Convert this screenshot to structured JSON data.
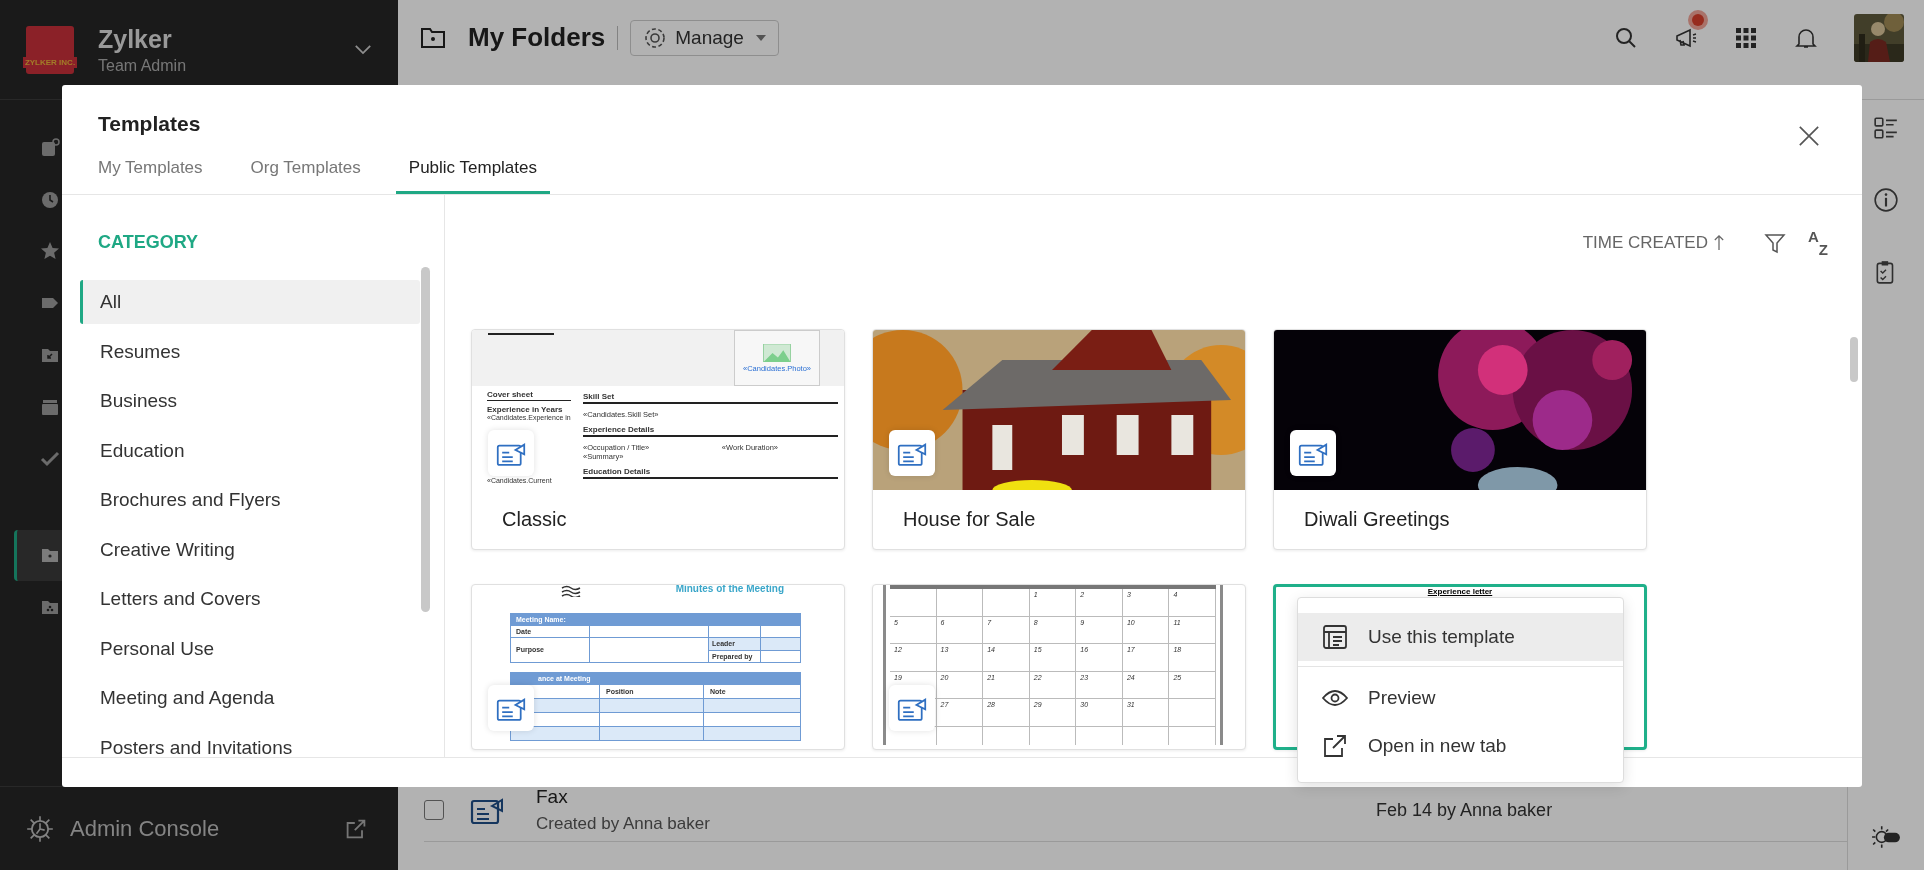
{
  "sidebar": {
    "org": {
      "name": "Zylker",
      "role": "Team Admin",
      "logo_text": "ZYLKER INC."
    },
    "nav": [
      {
        "selected": false
      },
      {
        "selected": false
      },
      {
        "selected": false
      },
      {
        "selected": false
      },
      {
        "selected": false
      },
      {
        "selected": false
      },
      {
        "selected": false
      },
      {
        "selected": true
      },
      {
        "selected": false
      }
    ],
    "footer": {
      "label": "Admin Console"
    }
  },
  "topbar": {
    "title": "My Folders",
    "manage": "Manage"
  },
  "list": {
    "rows": [
      {
        "name": "Fax",
        "created": "Created by Anna baker",
        "modified": "Feb 14 by Anna baker",
        "checked": false
      }
    ]
  },
  "modal": {
    "title": "Templates",
    "tabs": [
      {
        "label": "My Templates",
        "selected": false
      },
      {
        "label": "Org Templates",
        "selected": false
      },
      {
        "label": "Public Templates",
        "selected": true
      }
    ],
    "category": {
      "heading": "CATEGORY",
      "items": [
        {
          "label": "All",
          "selected": true
        },
        {
          "label": "Resumes",
          "selected": false
        },
        {
          "label": "Business",
          "selected": false
        },
        {
          "label": "Education",
          "selected": false
        },
        {
          "label": "Brochures and Flyers",
          "selected": false
        },
        {
          "label": "Creative Writing",
          "selected": false
        },
        {
          "label": "Letters and Covers",
          "selected": false
        },
        {
          "label": "Personal Use",
          "selected": false
        },
        {
          "label": "Meeting and Agenda",
          "selected": false
        },
        {
          "label": "Posters and Invitations",
          "selected": false
        }
      ]
    },
    "sort": {
      "label": "TIME CREATED",
      "letters": [
        "A",
        "Z"
      ]
    },
    "cards": [
      {
        "name": "Classic",
        "selected": false,
        "thumb": {
          "kind": "resume",
          "photo_label": "«Candidates.Photo»",
          "left": [
            {
              "kind": "heading",
              "text": "Cover sheet"
            },
            {
              "kind": "label",
              "text": "Experience in Years"
            },
            {
              "kind": "field",
              "text": "«Candidates.Experience in"
            },
            {
              "kind": "low",
              "text": "«Candidates.Current"
            }
          ],
          "right": [
            {
              "kind": "heading",
              "text": "Skill Set"
            },
            {
              "kind": "field",
              "text": "«Candidates.Skill Set»"
            },
            {
              "kind": "heading",
              "text": "Experience Details"
            },
            {
              "kind": "pair",
              "text": "«Occupation / Title»",
              "aside": "«Work Duration»"
            },
            {
              "kind": "field",
              "text": "«Summary»"
            },
            {
              "kind": "heading",
              "text": "Education Details"
            }
          ]
        }
      },
      {
        "name": "House for Sale",
        "selected": false
      },
      {
        "name": "Diwali Greetings",
        "selected": false
      },
      {
        "selected": false,
        "thumb": {
          "kind": "minutes",
          "title": "Minutes of the Meeting",
          "head": "Meeting Name:",
          "date": "Date",
          "purpose": "Purpose",
          "leader": "Leader",
          "prepared": "Prepared by",
          "attendance": "ance at Meeting",
          "columns": [
            "Position",
            "Note"
          ]
        }
      },
      {
        "selected": false,
        "thumb": {
          "kind": "calendar",
          "weeks": [
            [
              {
                "kind": "blank"
              },
              {
                "kind": "blank"
              },
              {
                "kind": "blank"
              },
              {
                "kind": "date",
                "day": "1"
              },
              {
                "kind": "date",
                "day": "2"
              },
              {
                "kind": "date",
                "day": "3"
              },
              {
                "kind": "date",
                "day": "4"
              }
            ],
            [
              {
                "kind": "date",
                "day": "5"
              },
              {
                "kind": "date",
                "day": "6"
              },
              {
                "kind": "date",
                "day": "7"
              },
              {
                "kind": "date",
                "day": "8"
              },
              {
                "kind": "date",
                "day": "9"
              },
              {
                "kind": "date",
                "day": "10"
              },
              {
                "kind": "date",
                "day": "11"
              }
            ],
            [
              {
                "kind": "date",
                "day": "12"
              },
              {
                "kind": "date",
                "day": "13"
              },
              {
                "kind": "date",
                "day": "14"
              },
              {
                "kind": "date",
                "day": "15"
              },
              {
                "kind": "date",
                "day": "16"
              },
              {
                "kind": "date",
                "day": "17"
              },
              {
                "kind": "date",
                "day": "18"
              }
            ],
            [
              {
                "kind": "date",
                "day": "19"
              },
              {
                "kind": "date",
                "day": "20"
              },
              {
                "kind": "date",
                "day": "21"
              },
              {
                "kind": "date",
                "day": "22"
              },
              {
                "kind": "date",
                "day": "23"
              },
              {
                "kind": "date",
                "day": "24"
              },
              {
                "kind": "date",
                "day": "25"
              }
            ],
            [
              {
                "kind": "blank"
              },
              {
                "kind": "date",
                "day": "27"
              },
              {
                "kind": "date",
                "day": "28"
              },
              {
                "kind": "date",
                "day": "29"
              },
              {
                "kind": "date",
                "day": "30"
              },
              {
                "kind": "date",
                "day": "31"
              },
              {
                "kind": "blank"
              }
            ],
            [
              {
                "kind": "blank"
              },
              {
                "kind": "blank"
              },
              {
                "kind": "blank"
              },
              {
                "kind": "blank"
              },
              {
                "kind": "blank"
              },
              {
                "kind": "blank"
              },
              {
                "kind": "blank"
              }
            ]
          ]
        }
      },
      {
        "selected": true,
        "thumb": {
          "kind": "letter",
          "title": "Experience letter"
        }
      }
    ],
    "menu": {
      "items": [
        {
          "label": "Use this template",
          "selected": true
        },
        {
          "label": "Preview",
          "selected": false
        },
        {
          "label": "Open in new tab",
          "selected": false
        }
      ]
    }
  }
}
